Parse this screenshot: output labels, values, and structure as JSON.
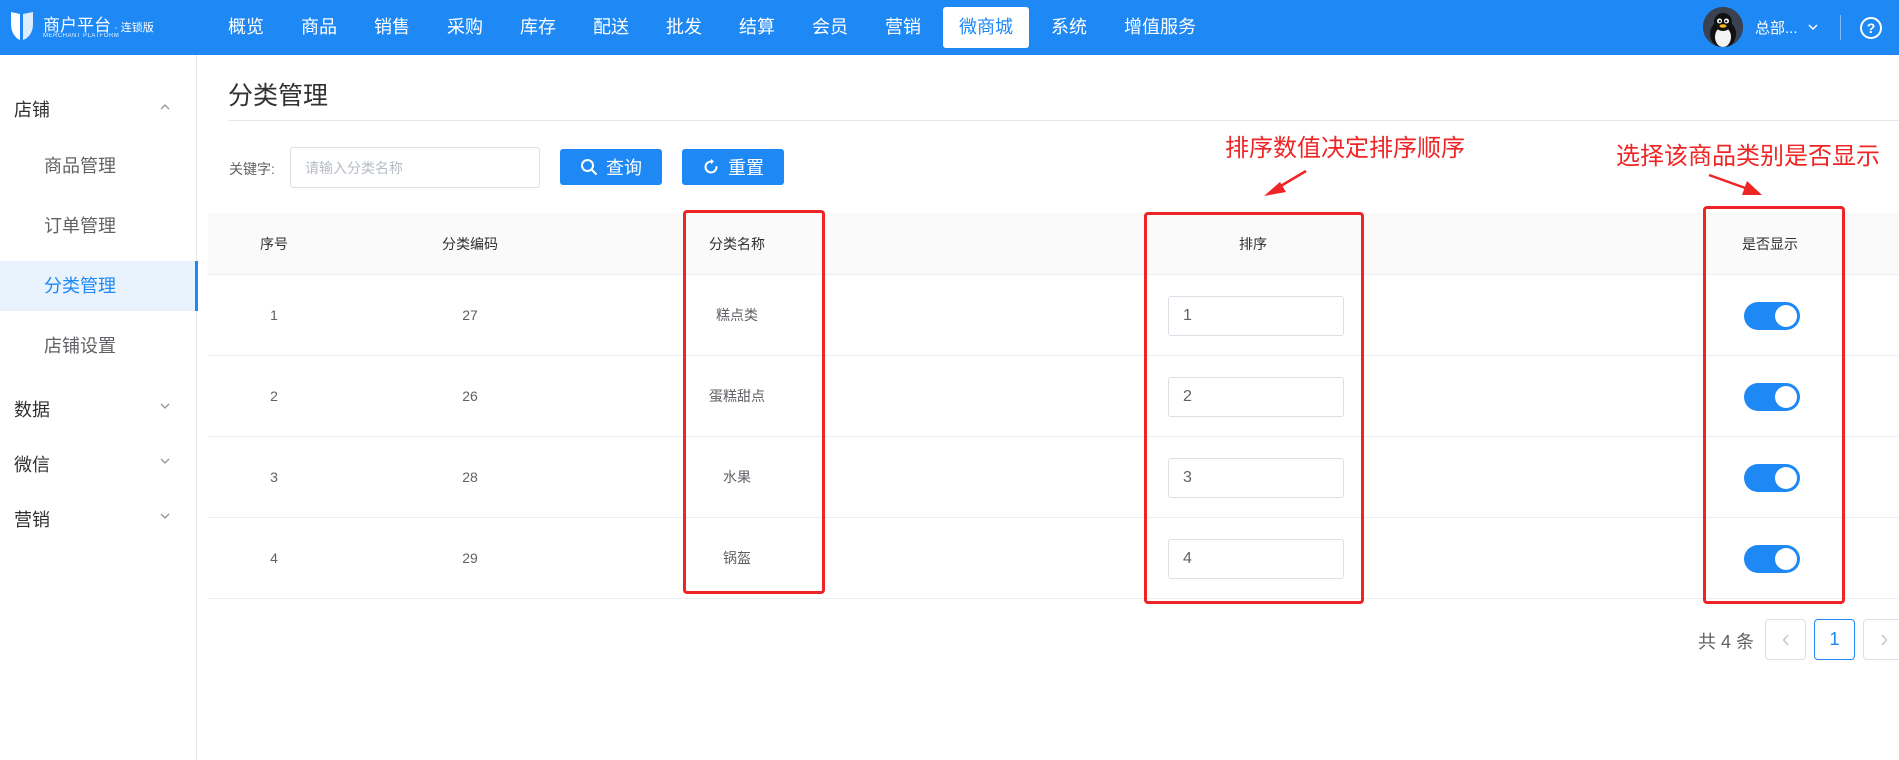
{
  "topbar": {
    "logo_title": "商户平台",
    "logo_tag": "· 连锁版",
    "logo_sub": "MERCHANT PLATFORM",
    "nav": [
      {
        "label": "概览"
      },
      {
        "label": "商品"
      },
      {
        "label": "销售"
      },
      {
        "label": "采购"
      },
      {
        "label": "库存"
      },
      {
        "label": "配送"
      },
      {
        "label": "批发"
      },
      {
        "label": "结算"
      },
      {
        "label": "会员"
      },
      {
        "label": "营销"
      },
      {
        "label": "微商城",
        "active": true
      },
      {
        "label": "系统"
      },
      {
        "label": "增值服务"
      }
    ],
    "user_name": "总部...",
    "help_label": "?"
  },
  "sidebar": {
    "groups": [
      {
        "label": "店铺",
        "expanded": true,
        "items": [
          {
            "label": "商品管理"
          },
          {
            "label": "订单管理"
          },
          {
            "label": "分类管理",
            "active": true
          },
          {
            "label": "店铺设置"
          }
        ]
      },
      {
        "label": "数据",
        "expanded": false
      },
      {
        "label": "微信",
        "expanded": false
      },
      {
        "label": "营销",
        "expanded": false
      }
    ]
  },
  "main": {
    "title": "分类管理",
    "search": {
      "label": "关键字:",
      "placeholder": "请输入分类名称",
      "value": "",
      "search_button": "查询",
      "reset_button": "重置"
    },
    "table": {
      "headers": {
        "index": "序号",
        "code": "分类编码",
        "name": "分类名称",
        "sort": "排序",
        "visible": "是否显示"
      },
      "rows": [
        {
          "index": "1",
          "code": "27",
          "name": "糕点类",
          "sort": "1",
          "visible": true
        },
        {
          "index": "2",
          "code": "26",
          "name": "蛋糕甜点",
          "sort": "2",
          "visible": true
        },
        {
          "index": "3",
          "code": "28",
          "name": "水果",
          "sort": "3",
          "visible": true
        },
        {
          "index": "4",
          "code": "29",
          "name": "锅盔",
          "sort": "4",
          "visible": true
        }
      ]
    },
    "pagination": {
      "total_text": "共 4 条",
      "current_page": "1"
    }
  },
  "annotations": {
    "sort_note": "排序数值决定排序顺序",
    "visible_note": "选择该商品类别是否显示",
    "color": "#ef2525"
  },
  "colors": {
    "primary": "#1e88f5",
    "active_bg": "#e8f3fe"
  }
}
